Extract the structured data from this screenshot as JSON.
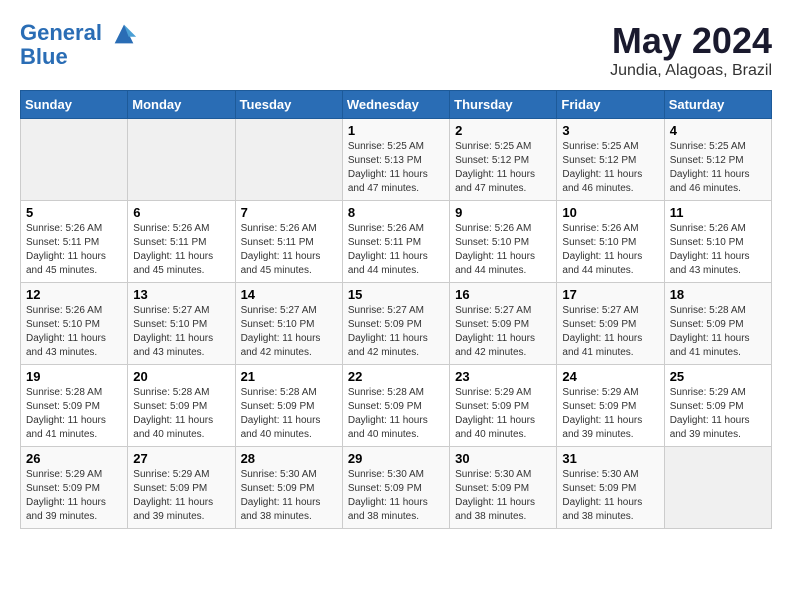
{
  "header": {
    "logo_line1": "General",
    "logo_line2": "Blue",
    "month_title": "May 2024",
    "location": "Jundia, Alagoas, Brazil"
  },
  "days_of_week": [
    "Sunday",
    "Monday",
    "Tuesday",
    "Wednesday",
    "Thursday",
    "Friday",
    "Saturday"
  ],
  "weeks": [
    [
      {
        "day": "",
        "info": ""
      },
      {
        "day": "",
        "info": ""
      },
      {
        "day": "",
        "info": ""
      },
      {
        "day": "1",
        "info": "Sunrise: 5:25 AM\nSunset: 5:13 PM\nDaylight: 11 hours\nand 47 minutes."
      },
      {
        "day": "2",
        "info": "Sunrise: 5:25 AM\nSunset: 5:12 PM\nDaylight: 11 hours\nand 47 minutes."
      },
      {
        "day": "3",
        "info": "Sunrise: 5:25 AM\nSunset: 5:12 PM\nDaylight: 11 hours\nand 46 minutes."
      },
      {
        "day": "4",
        "info": "Sunrise: 5:25 AM\nSunset: 5:12 PM\nDaylight: 11 hours\nand 46 minutes."
      }
    ],
    [
      {
        "day": "5",
        "info": "Sunrise: 5:26 AM\nSunset: 5:11 PM\nDaylight: 11 hours\nand 45 minutes."
      },
      {
        "day": "6",
        "info": "Sunrise: 5:26 AM\nSunset: 5:11 PM\nDaylight: 11 hours\nand 45 minutes."
      },
      {
        "day": "7",
        "info": "Sunrise: 5:26 AM\nSunset: 5:11 PM\nDaylight: 11 hours\nand 45 minutes."
      },
      {
        "day": "8",
        "info": "Sunrise: 5:26 AM\nSunset: 5:11 PM\nDaylight: 11 hours\nand 44 minutes."
      },
      {
        "day": "9",
        "info": "Sunrise: 5:26 AM\nSunset: 5:10 PM\nDaylight: 11 hours\nand 44 minutes."
      },
      {
        "day": "10",
        "info": "Sunrise: 5:26 AM\nSunset: 5:10 PM\nDaylight: 11 hours\nand 44 minutes."
      },
      {
        "day": "11",
        "info": "Sunrise: 5:26 AM\nSunset: 5:10 PM\nDaylight: 11 hours\nand 43 minutes."
      }
    ],
    [
      {
        "day": "12",
        "info": "Sunrise: 5:26 AM\nSunset: 5:10 PM\nDaylight: 11 hours\nand 43 minutes."
      },
      {
        "day": "13",
        "info": "Sunrise: 5:27 AM\nSunset: 5:10 PM\nDaylight: 11 hours\nand 43 minutes."
      },
      {
        "day": "14",
        "info": "Sunrise: 5:27 AM\nSunset: 5:10 PM\nDaylight: 11 hours\nand 42 minutes."
      },
      {
        "day": "15",
        "info": "Sunrise: 5:27 AM\nSunset: 5:09 PM\nDaylight: 11 hours\nand 42 minutes."
      },
      {
        "day": "16",
        "info": "Sunrise: 5:27 AM\nSunset: 5:09 PM\nDaylight: 11 hours\nand 42 minutes."
      },
      {
        "day": "17",
        "info": "Sunrise: 5:27 AM\nSunset: 5:09 PM\nDaylight: 11 hours\nand 41 minutes."
      },
      {
        "day": "18",
        "info": "Sunrise: 5:28 AM\nSunset: 5:09 PM\nDaylight: 11 hours\nand 41 minutes."
      }
    ],
    [
      {
        "day": "19",
        "info": "Sunrise: 5:28 AM\nSunset: 5:09 PM\nDaylight: 11 hours\nand 41 minutes."
      },
      {
        "day": "20",
        "info": "Sunrise: 5:28 AM\nSunset: 5:09 PM\nDaylight: 11 hours\nand 40 minutes."
      },
      {
        "day": "21",
        "info": "Sunrise: 5:28 AM\nSunset: 5:09 PM\nDaylight: 11 hours\nand 40 minutes."
      },
      {
        "day": "22",
        "info": "Sunrise: 5:28 AM\nSunset: 5:09 PM\nDaylight: 11 hours\nand 40 minutes."
      },
      {
        "day": "23",
        "info": "Sunrise: 5:29 AM\nSunset: 5:09 PM\nDaylight: 11 hours\nand 40 minutes."
      },
      {
        "day": "24",
        "info": "Sunrise: 5:29 AM\nSunset: 5:09 PM\nDaylight: 11 hours\nand 39 minutes."
      },
      {
        "day": "25",
        "info": "Sunrise: 5:29 AM\nSunset: 5:09 PM\nDaylight: 11 hours\nand 39 minutes."
      }
    ],
    [
      {
        "day": "26",
        "info": "Sunrise: 5:29 AM\nSunset: 5:09 PM\nDaylight: 11 hours\nand 39 minutes."
      },
      {
        "day": "27",
        "info": "Sunrise: 5:29 AM\nSunset: 5:09 PM\nDaylight: 11 hours\nand 39 minutes."
      },
      {
        "day": "28",
        "info": "Sunrise: 5:30 AM\nSunset: 5:09 PM\nDaylight: 11 hours\nand 38 minutes."
      },
      {
        "day": "29",
        "info": "Sunrise: 5:30 AM\nSunset: 5:09 PM\nDaylight: 11 hours\nand 38 minutes."
      },
      {
        "day": "30",
        "info": "Sunrise: 5:30 AM\nSunset: 5:09 PM\nDaylight: 11 hours\nand 38 minutes."
      },
      {
        "day": "31",
        "info": "Sunrise: 5:30 AM\nSunset: 5:09 PM\nDaylight: 11 hours\nand 38 minutes."
      },
      {
        "day": "",
        "info": ""
      }
    ]
  ]
}
